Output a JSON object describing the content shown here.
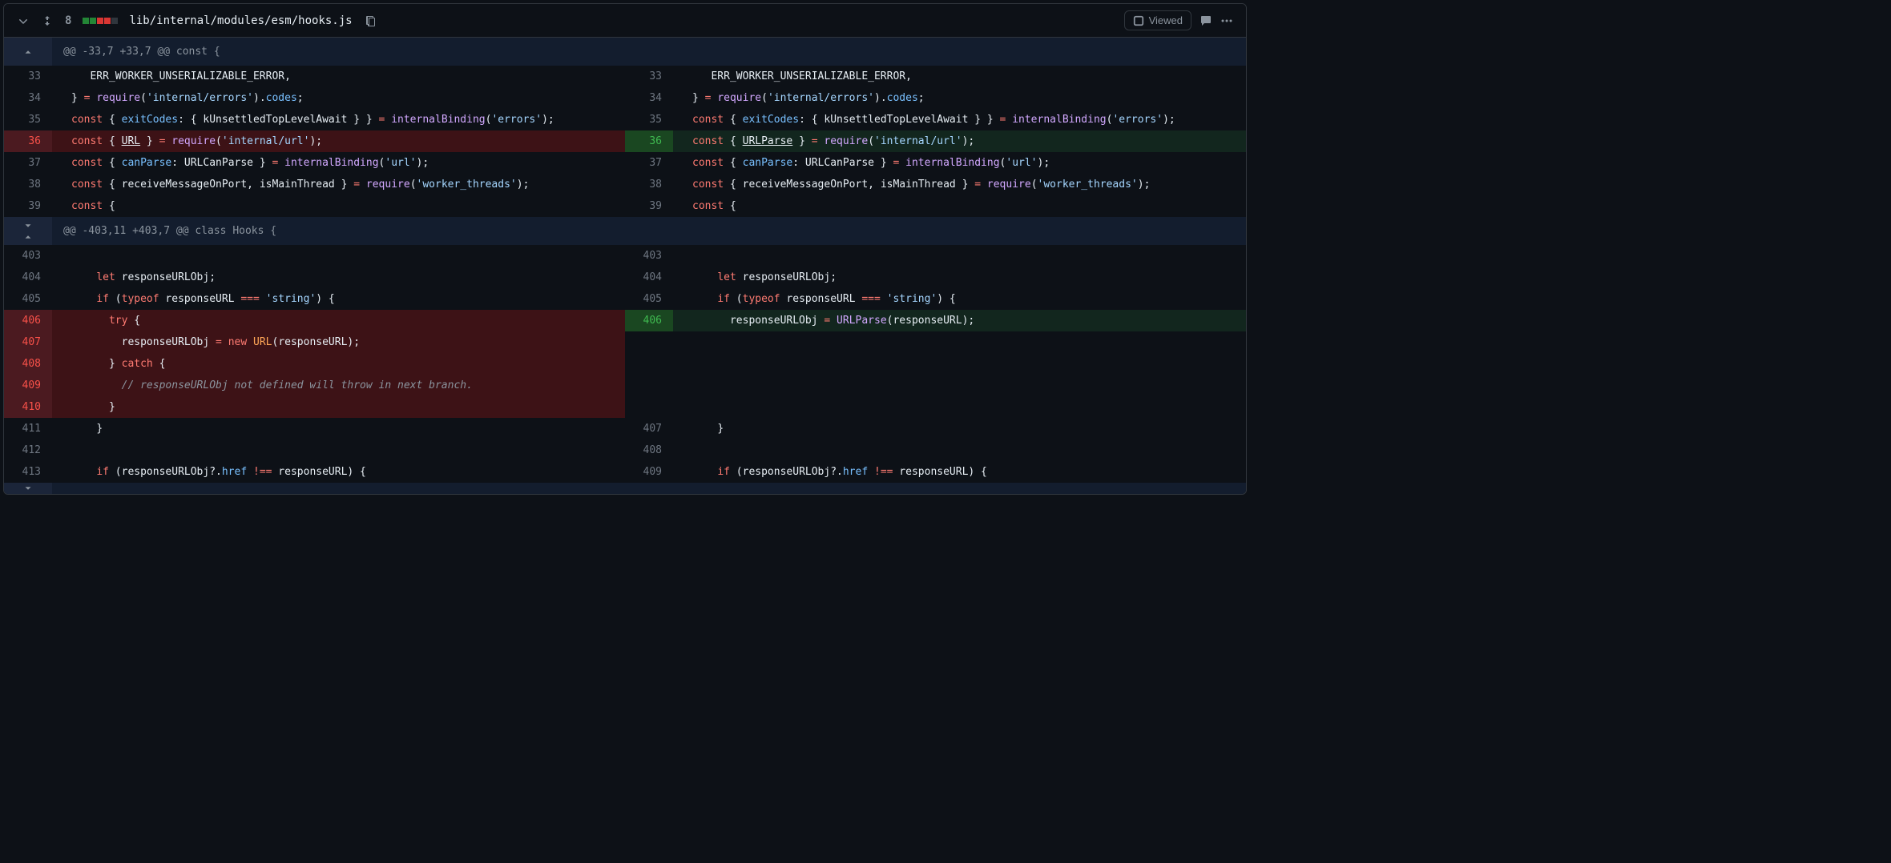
{
  "header": {
    "change_count": "8",
    "file_path": "lib/internal/modules/esm/hooks.js",
    "viewed_label": "Viewed",
    "diff_squares": [
      "add",
      "add",
      "del",
      "del",
      "neutral"
    ]
  },
  "hunks": [
    {
      "header": "@@ -33,7 +33,7 @@ const {",
      "expand_top": false,
      "expand_mid": false,
      "rows": [
        {
          "type": "ctx",
          "ln_l": "33",
          "ln_r": "33",
          "tokens": [
            [
              "id",
              "   ERR_WORKER_UNSERIALIZABLE_ERROR"
            ],
            [
              "punct",
              ","
            ]
          ]
        },
        {
          "type": "ctx",
          "ln_l": "34",
          "ln_r": "34",
          "tokens": [
            [
              "punct",
              "} "
            ],
            [
              "op",
              "="
            ],
            [
              "id",
              " "
            ],
            [
              "fn",
              "require"
            ],
            [
              "punct",
              "("
            ],
            [
              "str",
              "'internal/errors'"
            ],
            [
              "punct",
              ")."
            ],
            [
              "prop",
              "codes"
            ],
            [
              "punct",
              ";"
            ]
          ]
        },
        {
          "type": "ctx",
          "ln_l": "35",
          "ln_r": "35",
          "tokens": [
            [
              "kw",
              "const"
            ],
            [
              "id",
              " { "
            ],
            [
              "prop",
              "exitCodes"
            ],
            [
              "punct",
              ": { "
            ],
            [
              "id",
              "kUnsettledTopLevelAwait"
            ],
            [
              "punct",
              " } } "
            ],
            [
              "op",
              "="
            ],
            [
              "id",
              " "
            ],
            [
              "fn",
              "internalBinding"
            ],
            [
              "punct",
              "("
            ],
            [
              "str",
              "'errors'"
            ],
            [
              "punct",
              ");"
            ]
          ]
        },
        {
          "type": "change",
          "ln_l": "36",
          "ln_r": "36",
          "left_tokens": [
            [
              "kw",
              "const"
            ],
            [
              "id",
              " { "
            ],
            [
              "hl",
              "URL"
            ],
            [
              "id",
              " } "
            ],
            [
              "op",
              "="
            ],
            [
              "id",
              " "
            ],
            [
              "fn",
              "require"
            ],
            [
              "punct",
              "("
            ],
            [
              "str",
              "'internal/url'"
            ],
            [
              "punct",
              ");"
            ]
          ],
          "right_tokens": [
            [
              "kw",
              "const"
            ],
            [
              "id",
              " { "
            ],
            [
              "hl",
              "URLParse"
            ],
            [
              "id",
              " } "
            ],
            [
              "op",
              "="
            ],
            [
              "id",
              " "
            ],
            [
              "fn",
              "require"
            ],
            [
              "punct",
              "("
            ],
            [
              "str",
              "'internal/url'"
            ],
            [
              "punct",
              ");"
            ]
          ]
        },
        {
          "type": "ctx",
          "ln_l": "37",
          "ln_r": "37",
          "tokens": [
            [
              "kw",
              "const"
            ],
            [
              "id",
              " { "
            ],
            [
              "prop",
              "canParse"
            ],
            [
              "punct",
              ": "
            ],
            [
              "id",
              "URLCanParse"
            ],
            [
              "punct",
              " } "
            ],
            [
              "op",
              "="
            ],
            [
              "id",
              " "
            ],
            [
              "fn",
              "internalBinding"
            ],
            [
              "punct",
              "("
            ],
            [
              "str",
              "'url'"
            ],
            [
              "punct",
              ");"
            ]
          ]
        },
        {
          "type": "ctx",
          "ln_l": "38",
          "ln_r": "38",
          "tokens": [
            [
              "kw",
              "const"
            ],
            [
              "id",
              " { "
            ],
            [
              "id",
              "receiveMessageOnPort"
            ],
            [
              "punct",
              ", "
            ],
            [
              "id",
              "isMainThread"
            ],
            [
              "punct",
              " } "
            ],
            [
              "op",
              "="
            ],
            [
              "id",
              " "
            ],
            [
              "fn",
              "require"
            ],
            [
              "punct",
              "("
            ],
            [
              "str",
              "'worker_threads'"
            ],
            [
              "punct",
              ");"
            ]
          ]
        },
        {
          "type": "ctx",
          "ln_l": "39",
          "ln_r": "39",
          "tokens": [
            [
              "kw",
              "const"
            ],
            [
              "id",
              " {"
            ]
          ]
        }
      ]
    },
    {
      "header": "@@ -403,11 +403,7 @@ class Hooks {",
      "expand_top": true,
      "expand_mid": true,
      "rows": [
        {
          "type": "ctx",
          "ln_l": "403",
          "ln_r": "403",
          "tokens": [
            [
              "id",
              ""
            ]
          ]
        },
        {
          "type": "ctx",
          "ln_l": "404",
          "ln_r": "404",
          "tokens": [
            [
              "id",
              "    "
            ],
            [
              "kw",
              "let"
            ],
            [
              "id",
              " responseURLObj"
            ],
            [
              "punct",
              ";"
            ]
          ]
        },
        {
          "type": "ctx",
          "ln_l": "405",
          "ln_r": "405",
          "tokens": [
            [
              "id",
              "    "
            ],
            [
              "kw",
              "if"
            ],
            [
              "punct",
              " ("
            ],
            [
              "kw",
              "typeof"
            ],
            [
              "id",
              " responseURL "
            ],
            [
              "op",
              "==="
            ],
            [
              "id",
              " "
            ],
            [
              "str",
              "'string'"
            ],
            [
              "punct",
              ") {"
            ]
          ]
        },
        {
          "type": "change",
          "ln_l": "406",
          "ln_r": "406",
          "left_tokens": [
            [
              "id",
              "      "
            ],
            [
              "kw",
              "try"
            ],
            [
              "punct",
              " {"
            ]
          ],
          "right_tokens": [
            [
              "id",
              "      responseURLObj "
            ],
            [
              "op",
              "="
            ],
            [
              "id",
              " "
            ],
            [
              "fn",
              "URLParse"
            ],
            [
              "punct",
              "("
            ],
            [
              "id",
              "responseURL"
            ],
            [
              "punct",
              ");"
            ]
          ]
        },
        {
          "type": "delonly",
          "ln_l": "407",
          "left_tokens": [
            [
              "id",
              "        responseURLObj "
            ],
            [
              "op",
              "="
            ],
            [
              "id",
              " "
            ],
            [
              "kw",
              "new"
            ],
            [
              "id",
              " "
            ],
            [
              "new",
              "URL"
            ],
            [
              "punct",
              "("
            ],
            [
              "id",
              "responseURL"
            ],
            [
              "punct",
              ");"
            ]
          ]
        },
        {
          "type": "delonly",
          "ln_l": "408",
          "left_tokens": [
            [
              "id",
              "      "
            ],
            [
              "punct",
              "}"
            ],
            [
              "id",
              " "
            ],
            [
              "kw",
              "catch"
            ],
            [
              "punct",
              " {"
            ]
          ]
        },
        {
          "type": "delonly",
          "ln_l": "409",
          "left_tokens": [
            [
              "id",
              "        "
            ],
            [
              "cmt",
              "// responseURLObj not defined will throw in next branch."
            ]
          ]
        },
        {
          "type": "delonly",
          "ln_l": "410",
          "left_tokens": [
            [
              "id",
              "      "
            ],
            [
              "punct",
              "}"
            ]
          ]
        },
        {
          "type": "ctx",
          "ln_l": "411",
          "ln_r": "407",
          "tokens": [
            [
              "id",
              "    "
            ],
            [
              "punct",
              "}"
            ]
          ]
        },
        {
          "type": "ctx",
          "ln_l": "412",
          "ln_r": "408",
          "tokens": [
            [
              "id",
              ""
            ]
          ]
        },
        {
          "type": "ctx",
          "ln_l": "413",
          "ln_r": "409",
          "tokens": [
            [
              "id",
              "    "
            ],
            [
              "kw",
              "if"
            ],
            [
              "punct",
              " ("
            ],
            [
              "id",
              "responseURLObj"
            ],
            [
              "punct",
              "?."
            ],
            [
              "prop",
              "href"
            ],
            [
              "id",
              " "
            ],
            [
              "op",
              "!=="
            ],
            [
              "id",
              " responseURL"
            ],
            [
              "punct",
              ") {"
            ]
          ]
        }
      ]
    }
  ],
  "bottom_expand": true
}
